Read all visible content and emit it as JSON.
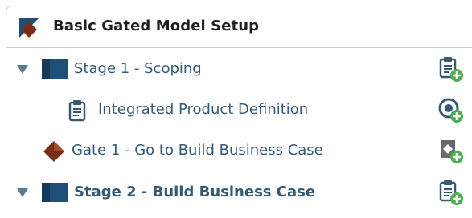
{
  "header": {
    "title": "Basic Gated Model Setup",
    "icon": "diamond-gate-icon"
  },
  "colors": {
    "stage_blue": "#1f4e79",
    "label_blue": "#345a77",
    "gate_brown": "#7a2d16",
    "add_green": "#4caf50",
    "icon_gray": "#6b6b6b",
    "chevron_blue": "#5a7a95"
  },
  "rows": [
    {
      "label": "Stage 1 - Scoping",
      "type": "stage",
      "expanded": true,
      "bold": false,
      "action_icon": "add-clipboard-icon"
    },
    {
      "label": "Integrated Product Definition",
      "type": "deliverable",
      "bold": false,
      "action_icon": "add-circle-icon"
    },
    {
      "label": "Gate 1 - Go to Build Business Case",
      "type": "gate",
      "bold": false,
      "action_icon": "add-gate-icon"
    },
    {
      "label": "Stage 2 - Build Business Case",
      "type": "stage",
      "expanded": true,
      "bold": true,
      "action_icon": "add-clipboard-icon"
    }
  ]
}
